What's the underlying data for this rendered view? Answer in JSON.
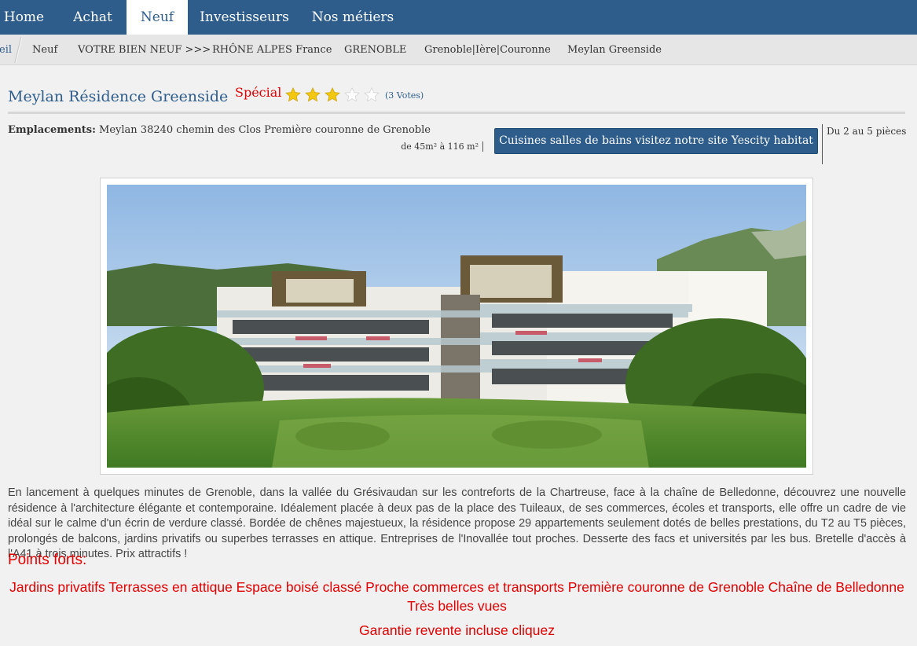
{
  "nav": {
    "items": [
      {
        "label": "Home"
      },
      {
        "label": "Achat"
      },
      {
        "label": "Neuf"
      },
      {
        "label": "Investisseurs"
      },
      {
        "label": "Nos métiers"
      }
    ],
    "active": "Neuf",
    "color": "#2e5d8c"
  },
  "breadcrumb": {
    "first": "eil",
    "items": [
      "Neuf",
      "VOTRE BIEN NEUF >>>",
      "RHÔNE ALPES France",
      "GRENOBLE",
      "Grenoble|Ière|Couronne",
      "Meylan Greenside"
    ]
  },
  "listing": {
    "title": "Meylan Résidence Greenside",
    "badge": "Spécial",
    "rating": {
      "filled": 3,
      "max": 5,
      "votes": "(3 Votes)"
    },
    "location_label": "Emplacements:",
    "location": "Meylan 38240 chemin des Clos Première couronne de Grenoble",
    "surface": "de 45m² à 116 m²",
    "cta_label": "Cuisines salles de bains visitez notre site Yescity habitat",
    "rooms": "Du 2 au 5 pièces",
    "photo_icon": "building-photo"
  },
  "description": "En lancement à quelques minutes de Grenoble, dans la vallée du Grésivaudan sur les contreforts de la Chartreuse, face à la chaîne de Belledonne, découvrez une nouvelle résidence à l'architecture élégante et contemporaine. Idéalement placée à deux pas de la place des Tuileaux, de ses commerces, écoles et transports, elle offre un cadre de vie idéal sur le calme d'un écrin de verdure classé. Bordée de chênes majestueux, la résidence propose 29 appartements seulement dotés de belles prestations, du T2 au T5 pièces, prolongés de balcons, jardins privatifs ou superbes terrasses en attique. Entreprises de l'Inovallée tout proches. Desserte des facs et universités par les bus. Bretelle d'accès à l'A41 à trois minutes. Prix attractifs !",
  "points_forts": {
    "title": "Points forts:",
    "text": "Jardins privatifs Terrasses en attique Espace boisé classé Proche commerces et transports Première couronne de Grenoble Chaîne de Belledonne Très belles vues",
    "link": "Garantie revente incluse cliquez",
    "color": "#e00000"
  }
}
